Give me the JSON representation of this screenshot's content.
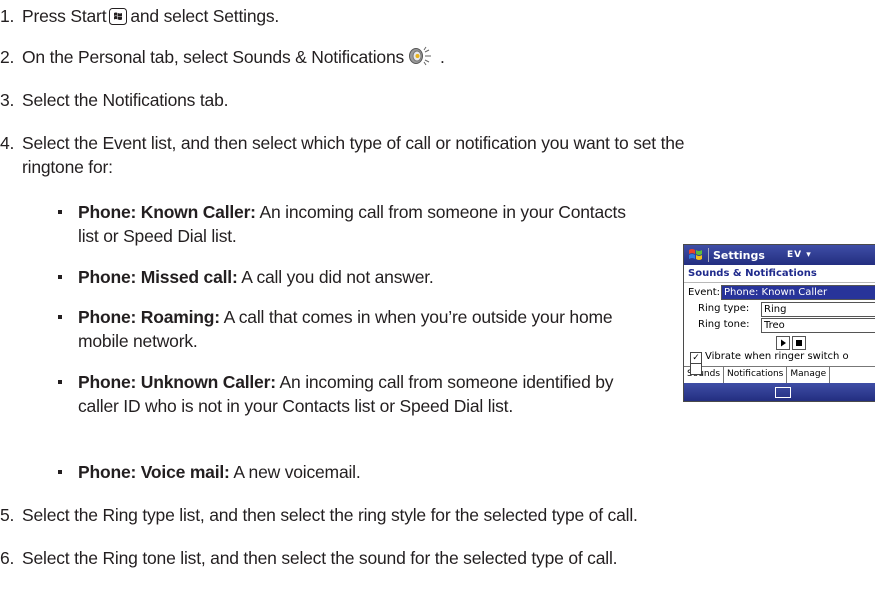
{
  "steps": [
    {
      "num": "1.",
      "pre": "Press Start",
      "post": "and select Settings."
    },
    {
      "num": "2.",
      "pre": "On the Personal tab, select Sounds & Notifications",
      "post": "."
    },
    {
      "num": "3.",
      "text": "Select the Notifications tab."
    },
    {
      "num": "4.",
      "line1": "Select the Event list, and then select which type of call or notification you want to set the",
      "line2": "ringtone for:"
    },
    {
      "num": "5.",
      "text": "Select the Ring type list, and then select the ring style for the selected type of call."
    },
    {
      "num": "6.",
      "text": "Select the Ring tone list, and then select the sound for the selected type of call."
    }
  ],
  "bullets": [
    {
      "term": "Phone: Known Caller:",
      "desc": "An incoming call from someone in your Contacts list or Speed Dial list."
    },
    {
      "term": "Phone: Missed call:",
      "desc": "A call you did not answer."
    },
    {
      "term": "Phone: Roaming:",
      "desc": "A call that comes in when you’re outside your home mobile network."
    },
    {
      "term": "Phone: Unknown Caller:",
      "desc": "An incoming call from someone identified by caller ID who is not in your Contacts list or Speed Dial list."
    },
    {
      "term": "Phone: Voice mail:",
      "desc": "A new voicemail."
    }
  ],
  "icons": {
    "start": "start-flag-icon",
    "sounds": "speaker-icon"
  },
  "device": {
    "title": "Settings",
    "indicators": "EV",
    "subtitle": "Sounds & Notifications",
    "event_label": "Event:",
    "event_value": "Phone: Known Caller",
    "ring_type_label": "Ring type:",
    "ring_type_value": "Ring",
    "ring_tone_label": "Ring tone:",
    "ring_tone_value": "Treo",
    "vibrate_on": "Vibrate when ringer switch o",
    "vibrate_off": "Vibrate when ringer switch o",
    "tabs": [
      "Sounds",
      "Notifications",
      "Manage"
    ],
    "colors": {
      "title_bar": "#28349a",
      "subtitle": "#1f2a8c"
    }
  }
}
